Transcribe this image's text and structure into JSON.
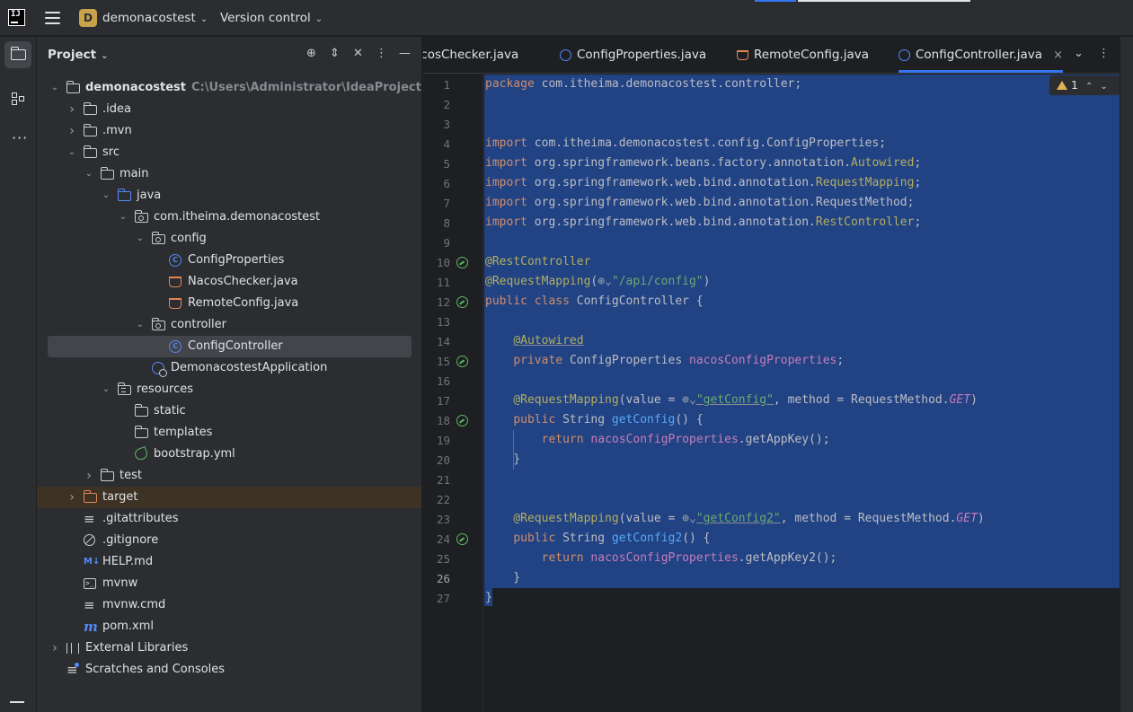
{
  "titlebar": {
    "logo_text": "IJ",
    "project_badge": "D",
    "project_name": "demonacostest",
    "vcs_label": "Version control"
  },
  "icons": {
    "app": "intellij-logo-icon",
    "menu": "hamburger-menu-icon",
    "project_tool": "folder-icon",
    "structure_tool": "structure-icon",
    "more_tools": "more-dots-icon",
    "bottom_tool": "terminal-icon"
  },
  "project_panel": {
    "title": "Project",
    "actions": [
      "locate-icon",
      "expand-icon",
      "collapse-icon",
      "options-icon",
      "hide-icon"
    ],
    "tree": [
      {
        "depth": 0,
        "arrow": "open",
        "icon": "folder",
        "label": "demonacostest",
        "path": "C:\\Users\\Administrator\\IdeaProjects\\demon",
        "bold": true
      },
      {
        "depth": 1,
        "arrow": "closed",
        "icon": "folder",
        "label": ".idea"
      },
      {
        "depth": 1,
        "arrow": "closed",
        "icon": "folder",
        "label": ".mvn"
      },
      {
        "depth": 1,
        "arrow": "open",
        "icon": "folder",
        "label": "src"
      },
      {
        "depth": 2,
        "arrow": "open",
        "icon": "folder",
        "label": "main"
      },
      {
        "depth": 3,
        "arrow": "open",
        "icon": "folder-blue",
        "label": "java"
      },
      {
        "depth": 4,
        "arrow": "open",
        "icon": "package",
        "label": "com.itheima.demonacostest"
      },
      {
        "depth": 5,
        "arrow": "open",
        "icon": "package",
        "label": "config"
      },
      {
        "depth": 6,
        "arrow": "",
        "icon": "class",
        "label": "ConfigProperties"
      },
      {
        "depth": 6,
        "arrow": "",
        "icon": "java",
        "label": "NacosChecker.java"
      },
      {
        "depth": 6,
        "arrow": "",
        "icon": "java",
        "label": "RemoteConfig.java"
      },
      {
        "depth": 5,
        "arrow": "open",
        "icon": "package",
        "label": "controller"
      },
      {
        "depth": 6,
        "arrow": "",
        "icon": "class",
        "label": "ConfigController",
        "selected": true
      },
      {
        "depth": 5,
        "arrow": "",
        "icon": "app",
        "label": "DemonacostestApplication"
      },
      {
        "depth": 3,
        "arrow": "open",
        "icon": "resources",
        "label": "resources"
      },
      {
        "depth": 4,
        "arrow": "",
        "icon": "folder",
        "label": "static"
      },
      {
        "depth": 4,
        "arrow": "",
        "icon": "folder",
        "label": "templates"
      },
      {
        "depth": 4,
        "arrow": "",
        "icon": "yml",
        "label": "bootstrap.yml"
      },
      {
        "depth": 2,
        "arrow": "closed",
        "icon": "folder",
        "label": "test"
      },
      {
        "depth": 1,
        "arrow": "closed",
        "icon": "folder-orange",
        "label": "target",
        "excluded": true
      },
      {
        "depth": 1,
        "arrow": "",
        "icon": "lines",
        "label": ".gitattributes"
      },
      {
        "depth": 1,
        "arrow": "",
        "icon": "ban",
        "label": ".gitignore"
      },
      {
        "depth": 1,
        "arrow": "",
        "icon": "md",
        "label": "HELP.md"
      },
      {
        "depth": 1,
        "arrow": "",
        "icon": "term",
        "label": "mvnw"
      },
      {
        "depth": 1,
        "arrow": "",
        "icon": "lines",
        "label": "mvnw.cmd"
      },
      {
        "depth": 1,
        "arrow": "",
        "icon": "m",
        "label": "pom.xml"
      },
      {
        "depth": 0,
        "arrow": "closed",
        "icon": "lib",
        "label": "External Libraries"
      },
      {
        "depth": 0,
        "arrow": "",
        "icon": "scratch",
        "label": "Scratches and Consoles"
      }
    ]
  },
  "editor": {
    "tabs": [
      {
        "label": "acosChecker.java",
        "icon": "java"
      },
      {
        "label": "ConfigProperties.java",
        "icon": "class"
      },
      {
        "label": "RemoteConfig.java",
        "icon": "java"
      },
      {
        "label": "ConfigController.java",
        "icon": "class",
        "active": true,
        "close": "×"
      }
    ],
    "inspection": {
      "count": "1"
    },
    "lines": [
      [
        [
          "kw",
          "package "
        ],
        [
          "",
          "com.itheima.demonacostest.controller;"
        ]
      ],
      [],
      [],
      [
        [
          "kw",
          "import "
        ],
        [
          "",
          "com.itheima.demonacostest.config.ConfigProperties;"
        ]
      ],
      [
        [
          "kw",
          "import "
        ],
        [
          "",
          "org.springframework.beans.factory.annotation."
        ],
        [
          "an",
          "Autowired"
        ],
        [
          "",
          ";"
        ]
      ],
      [
        [
          "kw",
          "import "
        ],
        [
          "",
          "org.springframework.web.bind.annotation."
        ],
        [
          "an",
          "RequestMapping"
        ],
        [
          "",
          ";"
        ]
      ],
      [
        [
          "kw",
          "import "
        ],
        [
          "",
          "org.springframework.web.bind.annotation.RequestMethod;"
        ]
      ],
      [
        [
          "kw",
          "import "
        ],
        [
          "",
          "org.springframework.web.bind.annotation."
        ],
        [
          "an",
          "RestController"
        ],
        [
          "",
          ";"
        ]
      ],
      [],
      [
        [
          "an",
          "@RestController"
        ]
      ],
      [
        [
          "an",
          "@RequestMapping"
        ],
        [
          "",
          "("
        ],
        [
          "globe",
          "⊕⌄"
        ],
        [
          "st",
          "\"/api/config\""
        ],
        [
          "",
          ")"
        ]
      ],
      [
        [
          "kw",
          "public class "
        ],
        [
          "",
          "ConfigController {"
        ]
      ],
      [],
      [
        [
          "",
          "    "
        ],
        [
          "an ul",
          "@Autowired"
        ]
      ],
      [
        [
          "",
          "    "
        ],
        [
          "kw",
          "private "
        ],
        [
          "",
          "ConfigProperties "
        ],
        [
          "fd",
          "nacosConfigProperties"
        ],
        [
          "",
          ";"
        ]
      ],
      [],
      [
        [
          "",
          "    "
        ],
        [
          "an",
          "@RequestMapping"
        ],
        [
          "",
          "(value = "
        ],
        [
          "globe",
          "⊕⌄"
        ],
        [
          "st ul",
          "\"getConfig\""
        ],
        [
          "",
          ", method = RequestMethod."
        ],
        [
          "it",
          "GET"
        ],
        [
          "",
          ")"
        ]
      ],
      [
        [
          "",
          "    "
        ],
        [
          "kw",
          "public "
        ],
        [
          "",
          "String "
        ],
        [
          "fn",
          "getConfig"
        ],
        [
          "",
          "() {"
        ]
      ],
      [
        [
          "",
          "        "
        ],
        [
          "kw",
          "return "
        ],
        [
          "fd",
          "nacosConfigProperties"
        ],
        [
          "",
          ".getAppKey();"
        ]
      ],
      [
        [
          "",
          "    }"
        ]
      ],
      [],
      [],
      [
        [
          "",
          "    "
        ],
        [
          "an",
          "@RequestMapping"
        ],
        [
          "",
          "(value = "
        ],
        [
          "globe",
          "⊕⌄"
        ],
        [
          "st ul",
          "\"getConfig2\""
        ],
        [
          "",
          ", method = RequestMethod."
        ],
        [
          "it",
          "GET"
        ],
        [
          "",
          ")"
        ]
      ],
      [
        [
          "",
          "    "
        ],
        [
          "kw",
          "public "
        ],
        [
          "",
          "String "
        ],
        [
          "fn",
          "getConfig2"
        ],
        [
          "",
          "() {"
        ]
      ],
      [
        [
          "",
          "        "
        ],
        [
          "kw",
          "return "
        ],
        [
          "fd",
          "nacosConfigProperties"
        ],
        [
          "",
          ".getAppKey2();"
        ]
      ],
      [
        [
          "",
          "    }"
        ]
      ],
      [
        [
          "",
          "}"
        ]
      ]
    ],
    "gutter_marks": [
      10,
      12,
      15,
      18,
      24
    ],
    "current_line": 26
  }
}
